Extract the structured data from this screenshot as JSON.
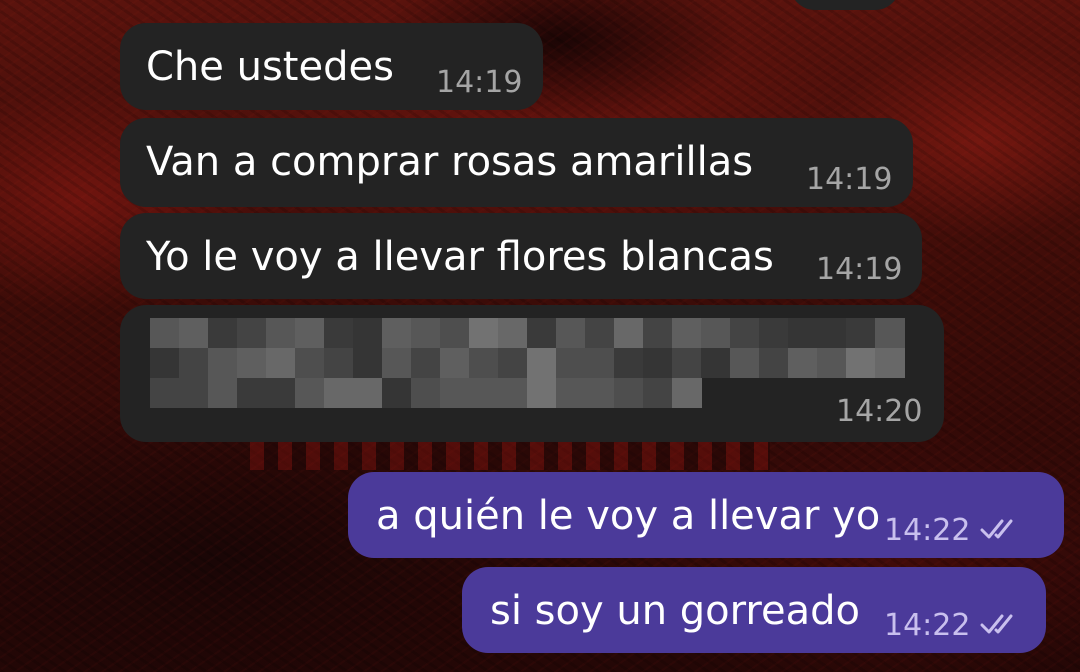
{
  "messages": [
    {
      "direction": "incoming",
      "text": "Che ustedes",
      "time": "14:19"
    },
    {
      "direction": "incoming",
      "text": "Van a comprar rosas amarillas",
      "time": "14:19"
    },
    {
      "direction": "incoming",
      "text": "Yo le voy a llevar flores blancas",
      "time": "14:19"
    },
    {
      "direction": "incoming",
      "text": "",
      "time": "14:20",
      "redacted": true
    },
    {
      "direction": "outgoing",
      "text": "a quién le voy a llevar yo",
      "time": "14:22",
      "status_icon": "double-check-icon"
    },
    {
      "direction": "outgoing",
      "text": "si soy un gorreado",
      "time": "14:22",
      "status_icon": "double-check-icon"
    }
  ],
  "colors": {
    "incoming_bubble": "#232323",
    "outgoing_bubble": "#4b3a9a",
    "text": "#ffffff",
    "incoming_time": "#a5a5a5",
    "outgoing_time": "#c9c0ee"
  }
}
